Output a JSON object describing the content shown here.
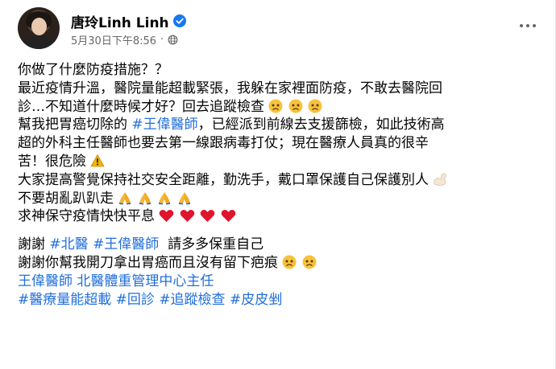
{
  "post": {
    "author": "唐玲Linh Linh",
    "date": "5月30日下午8:56",
    "separator": "·",
    "icons": {
      "verified": "verified-badge-icon",
      "audience": "globe-icon",
      "menu": "more-options-icon"
    },
    "colors": {
      "text": "#050505",
      "meta": "#65676b",
      "link": "#216fdb",
      "verified": "#1877f2"
    }
  },
  "content": {
    "l1": "你做了什麼防疫措施？？",
    "l2": "最近疫情升溫，醫院量能超載緊張，我躲在家裡面防疫，不敢去醫院回",
    "l3": "診…不知道什麼時候才好？回去追蹤檢查",
    "l4a": "幫我把胃癌切除的 ",
    "l4b": "#王偉醫師",
    "l4c": "，已經派到前線去支援篩檢，如此技術高",
    "l5": "超的外科主任醫師也要去第一線跟病毒打仗；現在醫療人員真的很辛",
    "l6": "苦！很危險",
    "l7": "大家提高警覺保持社交安全距離，勤洗手，戴口罩保護自己保護別人",
    "l8": "不要胡亂趴趴走",
    "l9": "求神保守疫情快快平息",
    "l10a": "謝謝 ",
    "l10b": "#北醫",
    "l10c": " ",
    "l10d": "#王偉醫師",
    "l10e": "  請多多保重自己",
    "l11": "謝謝你幫我開刀拿出胃癌而且沒有留下疤痕",
    "l12": "王偉醫師 北醫體重管理中心主任",
    "l13a": "#醫療量能超載",
    "l13b": " ",
    "l13c": "#回診",
    "l13d": " ",
    "l13e": "#追蹤檢查",
    "l13f": " ",
    "l13g": "#皮皮剉",
    "emoji": {
      "sad": "sad-face-emoji",
      "warning": "warning-emoji",
      "muscle": "flexed-biceps-emoji",
      "pray": "folded-hands-emoji",
      "heart": "red-heart-emoji"
    }
  }
}
